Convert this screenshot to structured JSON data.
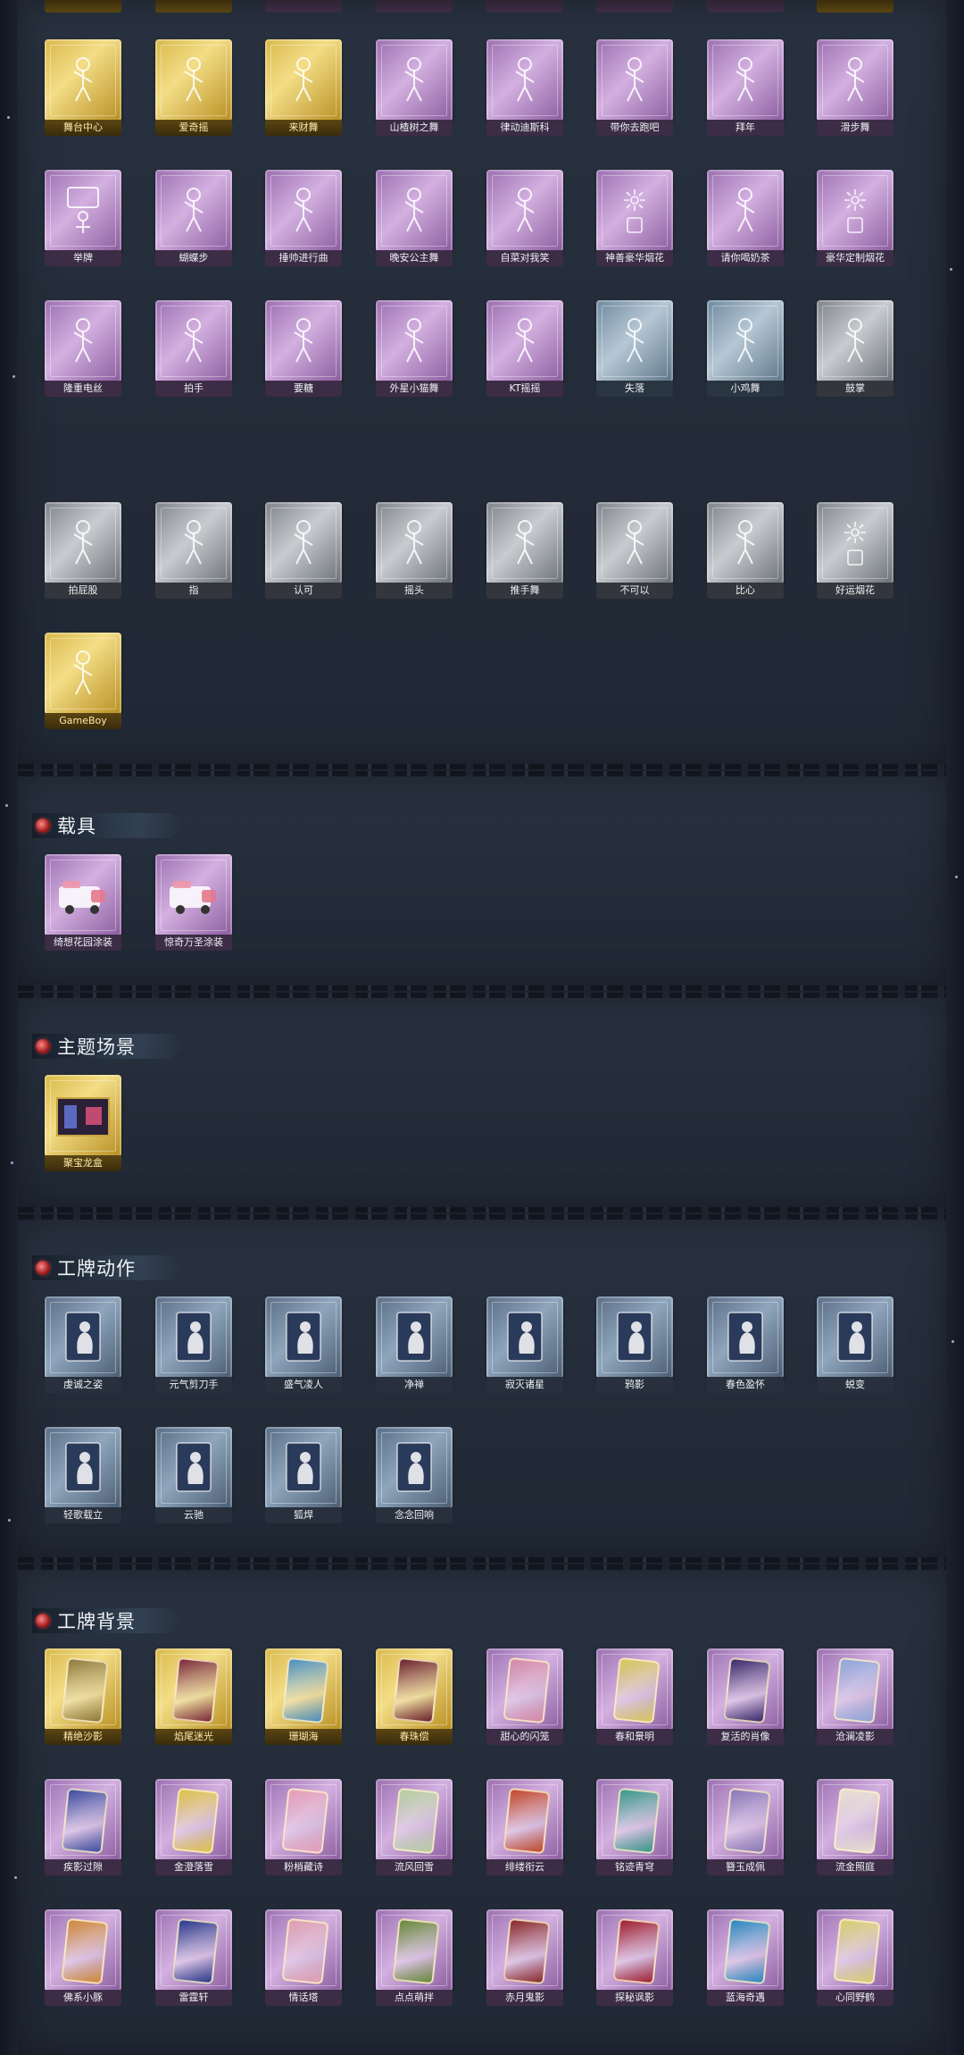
{
  "colors": {
    "gold": "#d9b84a",
    "purple": "#b48cc8",
    "blue": "#8fa6b8",
    "gray": "#a4a9af",
    "navy": "#6f86a0",
    "section_gem": "#c62a2a",
    "background": "#1b2230"
  },
  "top_partial_count": 8,
  "actions_row1": [
    {
      "label": "舞台中心",
      "tier": "gold",
      "icon": "dancer-icon"
    },
    {
      "label": "爱奇摇",
      "tier": "gold",
      "icon": "dancer-icon"
    },
    {
      "label": "来财舞",
      "tier": "gold",
      "icon": "dancer-icon"
    },
    {
      "label": "山楂树之舞",
      "tier": "purple",
      "icon": "dancer-icon"
    },
    {
      "label": "律动迪斯科",
      "tier": "purple",
      "icon": "dancer-icon"
    },
    {
      "label": "带你去跑吧",
      "tier": "purple",
      "icon": "dancer-icon"
    },
    {
      "label": "拜年",
      "tier": "purple",
      "icon": "dancer-icon"
    },
    {
      "label": "滑步舞",
      "tier": "purple",
      "icon": "dancer-icon"
    }
  ],
  "actions_row2": [
    {
      "label": "举牌",
      "tier": "purple",
      "icon": "sign-icon"
    },
    {
      "label": "蝴蝶步",
      "tier": "purple",
      "icon": "dancer-icon"
    },
    {
      "label": "捶帅进行曲",
      "tier": "purple",
      "icon": "dancer-icon"
    },
    {
      "label": "晚安公主舞",
      "tier": "purple",
      "icon": "dancer-icon"
    },
    {
      "label": "自菜对我笑",
      "tier": "purple",
      "icon": "dancer-icon"
    },
    {
      "label": "神善豪华烟花",
      "tier": "purple",
      "icon": "fireworks-icon"
    },
    {
      "label": "请你喝奶茶",
      "tier": "purple",
      "icon": "dancer-icon"
    },
    {
      "label": "豪华定制烟花",
      "tier": "purple",
      "icon": "fireworks-icon"
    }
  ],
  "actions_row3": [
    {
      "label": "隆重电丝",
      "tier": "purple",
      "icon": "dancer-icon"
    },
    {
      "label": "拍手",
      "tier": "purple",
      "icon": "hands-icon"
    },
    {
      "label": "要糖",
      "tier": "purple",
      "icon": "dancer-icon"
    },
    {
      "label": "外星小猫舞",
      "tier": "purple",
      "icon": "dancer-icon"
    },
    {
      "label": "KT摇摇",
      "tier": "purple",
      "icon": "dancer-icon"
    },
    {
      "label": "失落",
      "tier": "blue",
      "icon": "crawl-icon"
    },
    {
      "label": "小鸡舞",
      "tier": "blue",
      "icon": "dancer-icon"
    },
    {
      "label": "鼓掌",
      "tier": "gray",
      "icon": "hands-icon"
    }
  ],
  "actions_row4": [
    {
      "label": "拍屁股",
      "tier": "gray",
      "icon": "dancer-icon"
    },
    {
      "label": "指",
      "tier": "gray",
      "icon": "point-icon"
    },
    {
      "label": "认可",
      "tier": "gray",
      "icon": "thumb-icon"
    },
    {
      "label": "摇头",
      "tier": "gray",
      "icon": "dancer-icon"
    },
    {
      "label": "推手舞",
      "tier": "gray",
      "icon": "dancer-icon"
    },
    {
      "label": "不可以",
      "tier": "gray",
      "icon": "finger-icon"
    },
    {
      "label": "比心",
      "tier": "gray",
      "icon": "heart-hands-icon"
    },
    {
      "label": "好运烟花",
      "tier": "gray",
      "icon": "fireworks-icon"
    }
  ],
  "actions_row5": [
    {
      "label": "GameBoy",
      "tier": "gold",
      "icon": "dancer-icon"
    }
  ],
  "vehicles": {
    "title": "载具",
    "items": [
      {
        "label": "绮想花园涂装",
        "tier": "purple",
        "icon": "van-icon"
      },
      {
        "label": "惊奇万圣涂装",
        "tier": "purple",
        "icon": "van-icon"
      }
    ]
  },
  "scenes": {
    "title": "主题场景",
    "items": [
      {
        "label": "聚宝龙盒",
        "tier": "gold",
        "icon": "scene-icon"
      }
    ]
  },
  "badge_actions": {
    "title": "工牌动作",
    "row1": [
      {
        "label": "虔诚之姿",
        "tier": "navy",
        "icon": "badge-pose-icon"
      },
      {
        "label": "元气剪刀手",
        "tier": "navy",
        "icon": "badge-pose-icon"
      },
      {
        "label": "盛气凌人",
        "tier": "navy",
        "icon": "badge-pose-icon"
      },
      {
        "label": "净禅",
        "tier": "navy",
        "icon": "badge-pose-icon"
      },
      {
        "label": "寂灭诸星",
        "tier": "navy",
        "icon": "badge-pose-icon"
      },
      {
        "label": "鸦影",
        "tier": "navy",
        "icon": "badge-pose-icon"
      },
      {
        "label": "春色盈怀",
        "tier": "navy",
        "icon": "badge-pose-icon"
      },
      {
        "label": "蜕变",
        "tier": "navy",
        "icon": "badge-pose-icon"
      }
    ],
    "row2": [
      {
        "label": "轻歌载立",
        "tier": "navy",
        "icon": "badge-pose-icon"
      },
      {
        "label": "云驰",
        "tier": "navy",
        "icon": "badge-pose-icon"
      },
      {
        "label": "狐焊",
        "tier": "navy",
        "icon": "badge-pose-icon"
      },
      {
        "label": "念念回响",
        "tier": "navy",
        "icon": "badge-pose-icon"
      }
    ]
  },
  "badge_backgrounds": {
    "title": "工牌背景",
    "row1": [
      {
        "label": "精绝沙影",
        "tier": "gold",
        "art": "#8d7a3c"
      },
      {
        "label": "焰尾迷光",
        "tier": "gold",
        "art": "#7a2a3a"
      },
      {
        "label": "珊瑚海",
        "tier": "gold",
        "art": "#4a8fc2"
      },
      {
        "label": "春珠偿",
        "tier": "gold",
        "art": "#6a2030"
      },
      {
        "label": "甜心的闪笼",
        "tier": "purple",
        "art": "#d58aa6"
      },
      {
        "label": "春和景明",
        "tier": "purple",
        "art": "#d7c75a"
      },
      {
        "label": "复活的肖像",
        "tier": "purple",
        "art": "#3a2a6a"
      },
      {
        "label": "沧澜凌影",
        "tier": "purple",
        "art": "#8fa7d8"
      }
    ],
    "row2": [
      {
        "label": "疾影过隙",
        "tier": "purple",
        "art": "#3e4fa0"
      },
      {
        "label": "金澄落雪",
        "tier": "purple",
        "art": "#e0c44a"
      },
      {
        "label": "粉梢藏诗",
        "tier": "purple",
        "art": "#e6a0b8"
      },
      {
        "label": "流风回雪",
        "tier": "purple",
        "art": "#b8d0a0"
      },
      {
        "label": "绯缕衔云",
        "tier": "purple",
        "art": "#c24a2a"
      },
      {
        "label": "铭迹青穹",
        "tier": "purple",
        "art": "#3a9a8a"
      },
      {
        "label": "簪玉成佩",
        "tier": "purple",
        "art": "#8a7ab8"
      },
      {
        "label": "流金照庭",
        "tier": "purple",
        "art": "#e8e0d0"
      }
    ],
    "row3": [
      {
        "label": "佛系小豚",
        "tier": "purple",
        "art": "#d08a3a"
      },
      {
        "label": "雷霆轩",
        "tier": "purple",
        "art": "#2a3a8a"
      },
      {
        "label": "情话塔",
        "tier": "purple",
        "art": "#e0a0b0"
      },
      {
        "label": "点点萌拌",
        "tier": "purple",
        "art": "#6a8a3a"
      },
      {
        "label": "赤月鬼影",
        "tier": "purple",
        "art": "#8a2a2a"
      },
      {
        "label": "探秘讽影",
        "tier": "purple",
        "art": "#a02030"
      },
      {
        "label": "蓝海奇遇",
        "tier": "purple",
        "art": "#2a8ac0"
      },
      {
        "label": "心同野鹤",
        "tier": "purple",
        "art": "#d8d070"
      }
    ]
  }
}
